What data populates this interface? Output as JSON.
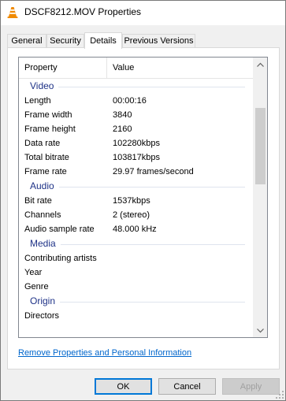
{
  "window": {
    "title": "DSCF8212.MOV Properties"
  },
  "tabs": [
    {
      "label": "General",
      "active": false
    },
    {
      "label": "Security",
      "active": false
    },
    {
      "label": "Details",
      "active": true
    },
    {
      "label": "Previous Versions",
      "active": false
    }
  ],
  "table": {
    "header": {
      "property": "Property",
      "value": "Value"
    },
    "groups": [
      {
        "name": "Video",
        "rows": [
          {
            "k": "Length",
            "v": "00:00:16"
          },
          {
            "k": "Frame width",
            "v": "3840"
          },
          {
            "k": "Frame height",
            "v": "2160"
          },
          {
            "k": "Data rate",
            "v": "102280kbps"
          },
          {
            "k": "Total bitrate",
            "v": "103817kbps"
          },
          {
            "k": "Frame rate",
            "v": "29.97 frames/second"
          }
        ]
      },
      {
        "name": "Audio",
        "rows": [
          {
            "k": "Bit rate",
            "v": "1537kbps"
          },
          {
            "k": "Channels",
            "v": "2 (stereo)"
          },
          {
            "k": "Audio sample rate",
            "v": "48.000 kHz"
          }
        ]
      },
      {
        "name": "Media",
        "rows": [
          {
            "k": "Contributing artists",
            "v": ""
          },
          {
            "k": "Year",
            "v": ""
          },
          {
            "k": "Genre",
            "v": ""
          }
        ]
      },
      {
        "name": "Origin",
        "rows": [
          {
            "k": "Directors",
            "v": ""
          }
        ]
      }
    ]
  },
  "link": {
    "label": "Remove Properties and Personal Information"
  },
  "buttons": {
    "ok": "OK",
    "cancel": "Cancel",
    "apply": "Apply"
  },
  "colors": {
    "group_header": "#1e3287",
    "link": "#0066cc",
    "accent": "#0078d7"
  },
  "icons": {
    "title": "vlc-cone-icon"
  }
}
